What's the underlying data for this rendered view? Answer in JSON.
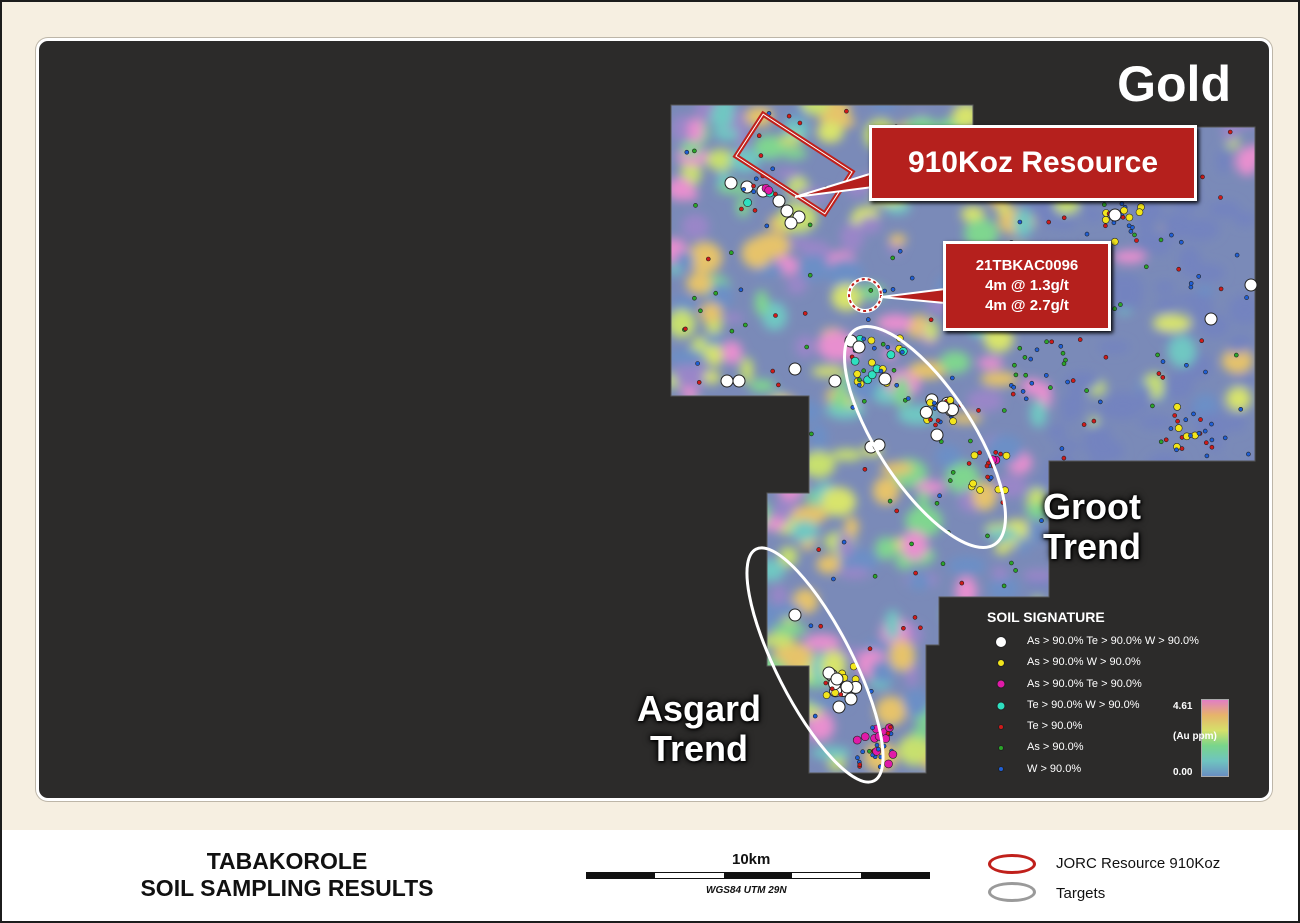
{
  "map": {
    "title": "Gold",
    "resource_callout": "910Koz Resource",
    "drillhole": {
      "id": "21TBKAC0096",
      "line1": "4m @ 1.3g/t",
      "line2": "4m @ 2.7g/t"
    },
    "trends": [
      {
        "line1": "Groot",
        "line2": "Trend"
      },
      {
        "line1": "Asgard",
        "line2": "Trend"
      }
    ]
  },
  "legend": {
    "title": "SOIL SIGNATURE",
    "items": [
      {
        "label": "As > 90.0%  Te > 90.0%  W > 90.0%",
        "color": "#ffffff"
      },
      {
        "label": "As > 90.0%  W > 90.0%",
        "color": "#f2e51c"
      },
      {
        "label": "As > 90.0%  Te > 90.0%",
        "color": "#e01aa8"
      },
      {
        "label": "Te > 90.0%  W > 90.0%",
        "color": "#2ee0c0"
      },
      {
        "label": "Te > 90.0%",
        "color": "#d01a1a"
      },
      {
        "label": "As > 90.0%",
        "color": "#2aa52a"
      },
      {
        "label": "W > 90.0%",
        "color": "#1f5fd6"
      }
    ],
    "colorbar": {
      "max": "4.61",
      "unit": "(Au ppm)",
      "min": "0.00"
    }
  },
  "footer": {
    "title_line1": "TABAKOROLE",
    "title_line2": "SOIL SAMPLING RESULTS",
    "scale_label": "10km",
    "projection": "WGS84 UTM 29N",
    "key": [
      {
        "label": "JORC Resource 910Koz",
        "color": "#c0201b"
      },
      {
        "label": "Targets",
        "color": "#9a9a9a"
      }
    ]
  }
}
